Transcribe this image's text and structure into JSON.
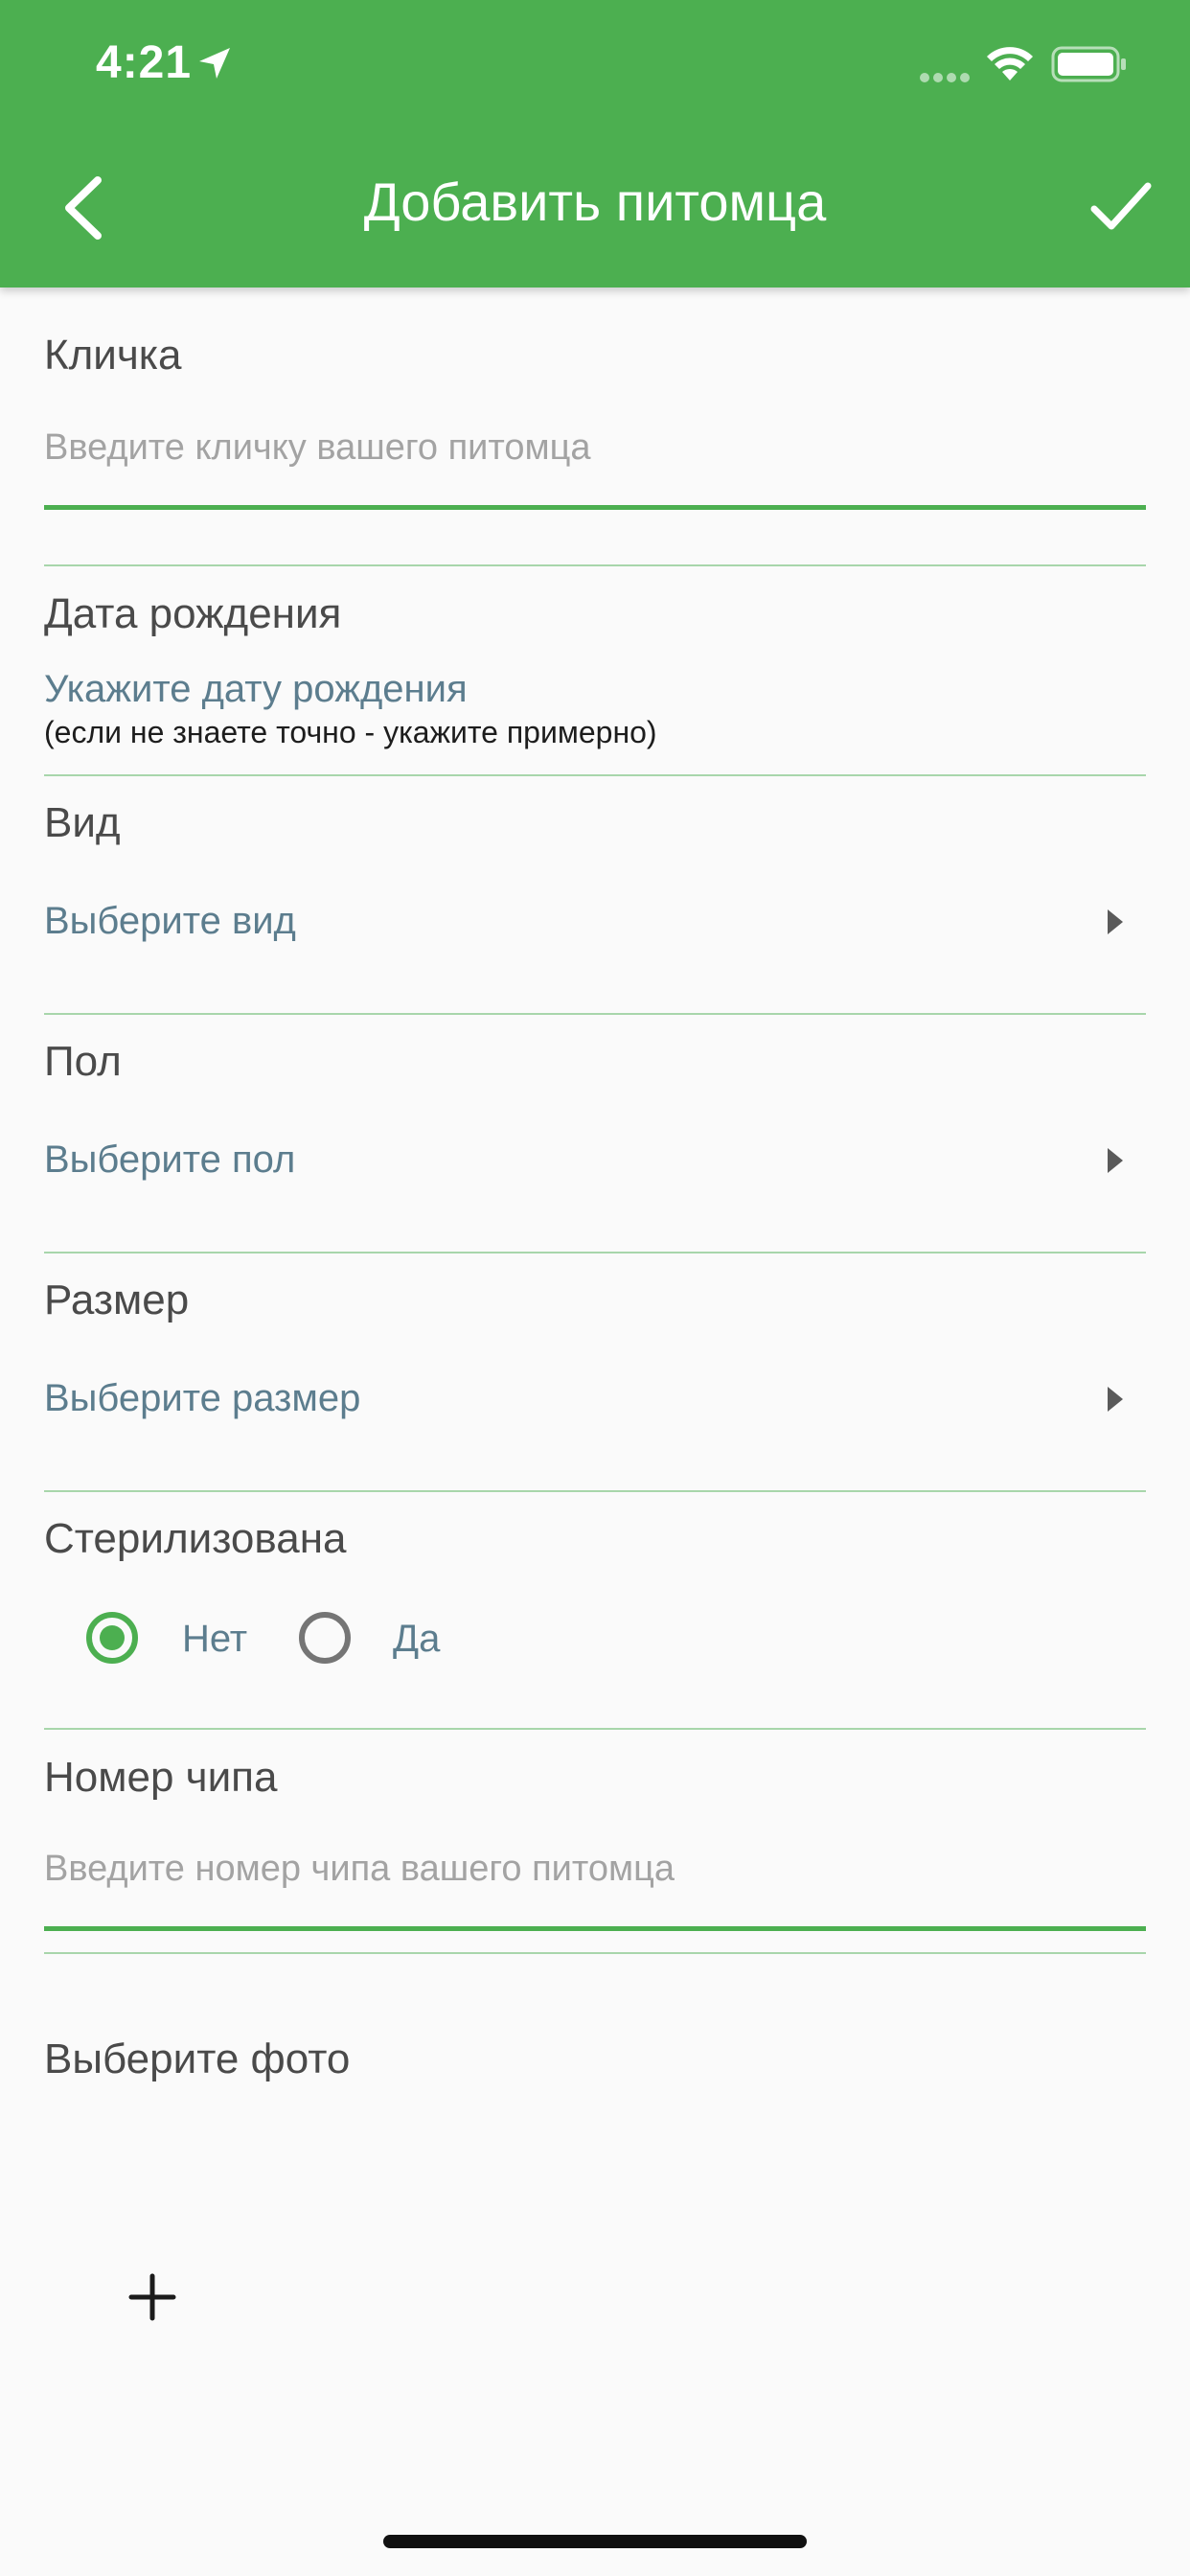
{
  "status_bar": {
    "time": "4:21"
  },
  "header": {
    "title": "Добавить питомца"
  },
  "form": {
    "name": {
      "label": "Кличка",
      "placeholder": "Введите кличку вашего питомца"
    },
    "birthdate": {
      "label": "Дата рождения",
      "link": "Укажите дату рождения",
      "hint": "(если не знаете точно - укажите примерно)"
    },
    "species": {
      "label": "Вид",
      "value": "Выберите вид"
    },
    "sex": {
      "label": "Пол",
      "value": "Выберите пол"
    },
    "size": {
      "label": "Размер",
      "value": "Выберите размер"
    },
    "sterilized": {
      "label": "Стерилизована",
      "options": [
        {
          "label": "Нет",
          "selected": true
        },
        {
          "label": "Да",
          "selected": false
        }
      ]
    },
    "chip": {
      "label": "Номер чипа",
      "placeholder": "Введите номер чипа вашего питомца"
    },
    "photo": {
      "label": "Выберите фото"
    }
  },
  "colors": {
    "accent": "#4caf50",
    "link": "#5c7d8e",
    "divider": "#a8d6ab"
  }
}
